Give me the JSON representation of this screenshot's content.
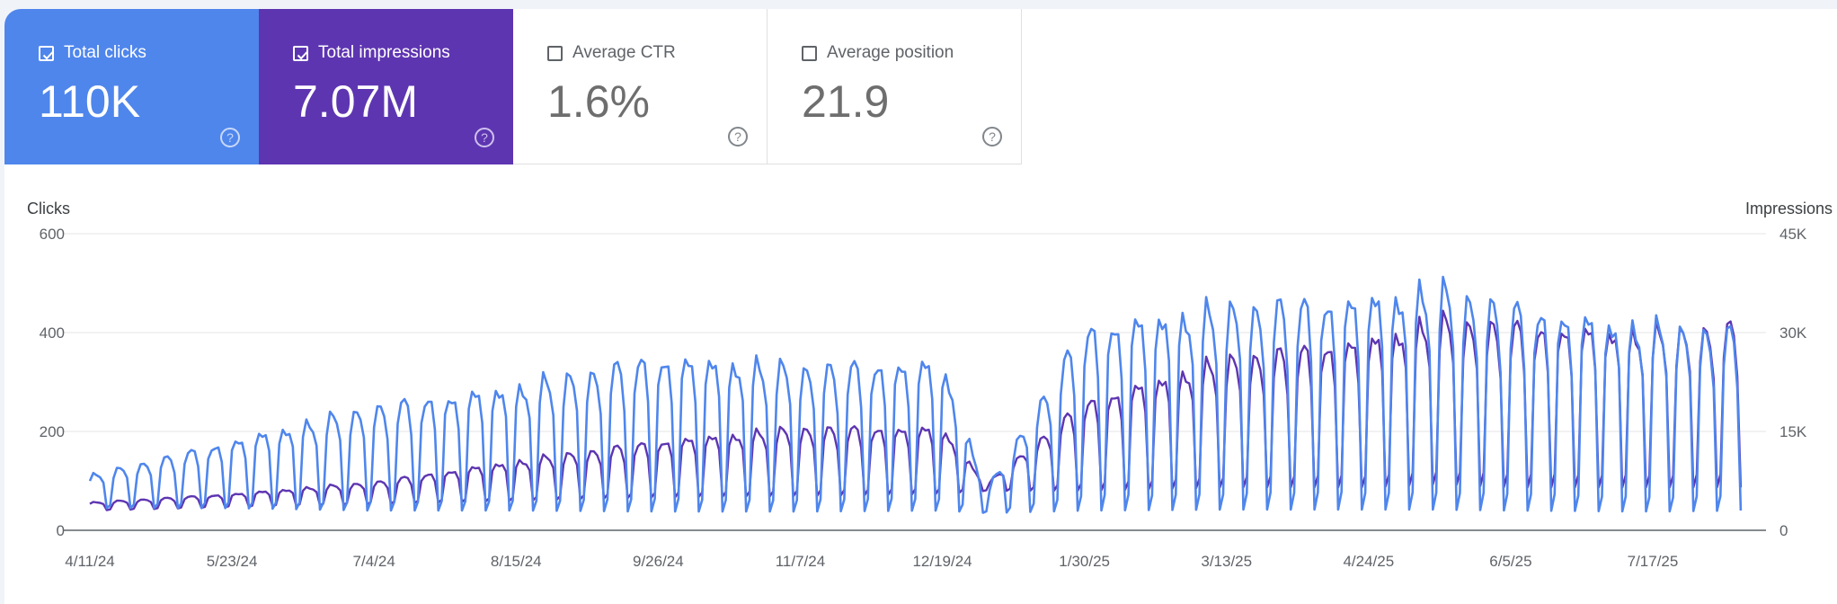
{
  "metrics": [
    {
      "label": "Total clicks",
      "value": "110K",
      "checked": true,
      "color": "#4f86ec"
    },
    {
      "label": "Total impressions",
      "value": "7.07M",
      "checked": true,
      "color": "#5e35b1"
    },
    {
      "label": "Average CTR",
      "value": "1.6%",
      "checked": false
    },
    {
      "label": "Average position",
      "value": "21.9",
      "checked": false
    }
  ],
  "chart_data": {
    "type": "line",
    "y_left_label": "Clicks",
    "y_right_label": "Impressions",
    "y_left_ticks": [
      "0",
      "200",
      "400",
      "600"
    ],
    "y_right_ticks": [
      "0",
      "15K",
      "30K",
      "45K"
    ],
    "ylim_left": [
      0,
      600
    ],
    "ylim_right": [
      0,
      45000
    ],
    "x_tick_labels": [
      "4/11/24",
      "5/23/24",
      "7/4/24",
      "8/15/24",
      "9/26/24",
      "11/7/24",
      "12/19/24",
      "1/30/25",
      "3/13/25",
      "4/24/25",
      "6/5/25",
      "7/17/25"
    ],
    "x_range": [
      "4/11/24",
      "8/12/25"
    ],
    "grid": true,
    "series_style": [
      {
        "metric": "Total clicks",
        "axis": "left",
        "color": "#4f86ec"
      },
      {
        "metric": "Total impressions",
        "axis": "right",
        "color": "#5e35b1"
      }
    ],
    "weekly_envelope": {
      "dates": [
        "4/11/24",
        "5/23/24",
        "7/4/24",
        "8/15/24",
        "9/26/24",
        "11/7/24",
        "12/19/24",
        "1/1/25",
        "1/30/25",
        "3/13/25",
        "4/24/25",
        "5/15/25",
        "6/5/25",
        "7/17/25",
        "8/12/25"
      ],
      "clicks_weekday_peak": [
        110,
        180,
        250,
        290,
        350,
        330,
        340,
        80,
        410,
        450,
        470,
        490,
        450,
        410,
        400
      ],
      "clicks_weekend_low": [
        45,
        45,
        40,
        40,
        38,
        38,
        40,
        35,
        40,
        42,
        42,
        42,
        40,
        38,
        40
      ],
      "impressions_weekday_peak": [
        4200,
        5500,
        7300,
        10500,
        13500,
        15500,
        15500,
        7000,
        19500,
        26000,
        29000,
        32000,
        31000,
        30000,
        31000
      ],
      "impressions_weekend_low": [
        3000,
        3500,
        4000,
        4500,
        5000,
        5200,
        5500,
        6000,
        6000,
        6500,
        6500,
        7000,
        6500,
        6500,
        6500
      ]
    }
  }
}
